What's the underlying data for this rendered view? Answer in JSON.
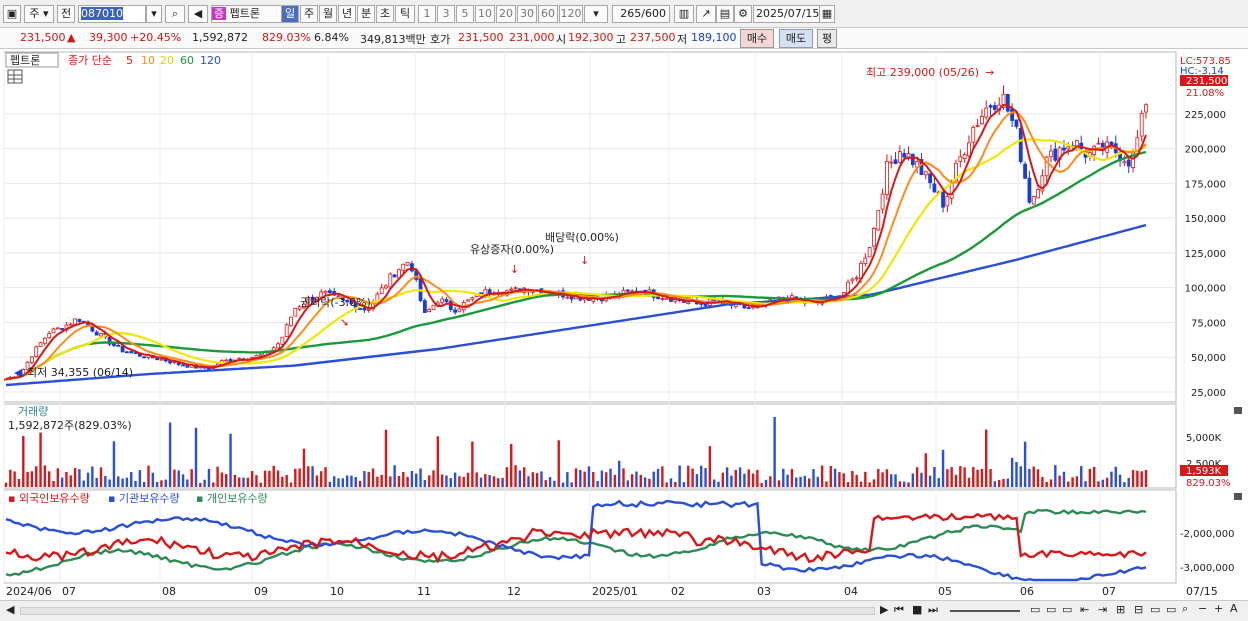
{
  "toolbar": {
    "item_type": "주",
    "prev_label": "전",
    "code": "087010",
    "stock_badge": "증",
    "stock_name": "펩트론",
    "period_buttons": [
      "일",
      "주",
      "월",
      "년",
      "분",
      "초",
      "틱"
    ],
    "active_period": "일",
    "interval_buttons": [
      "1",
      "3",
      "5",
      "10",
      "20",
      "30",
      "60",
      "120"
    ],
    "count": "265",
    "count_total": "/600",
    "date": "2025/07/15"
  },
  "infobar": {
    "price": "231,500",
    "change_arrow": "▲",
    "change": "39,300",
    "change_pct": "+20.45%",
    "volume": "1,592,872",
    "volume_ratio": "829.03%",
    "turnover": "6.84%",
    "amount": "349,813백만",
    "bid_label": "호가",
    "ask": "231,500",
    "bid": "231,000",
    "open_label": "시",
    "open": "192,300",
    "high_label": "고",
    "high": "237,500",
    "low_label": "저",
    "low": "189,100",
    "buy_label": "매수",
    "sell_label": "매도",
    "avg_label": "평"
  },
  "price_panel": {
    "stock_tab": "펩트론",
    "ma_legend": [
      "종가 단순",
      "5",
      "10",
      "20",
      "60",
      "120"
    ],
    "ma_colors": [
      "#d81818",
      "#ff8c1a",
      "#e8e000",
      "#1a9a3a",
      "#2a4fd8"
    ],
    "lc_label": "LC:573.85",
    "hc_label": "HC:-3.14",
    "last_price_tag": "231,500",
    "last_pct_tag": "21.08%",
    "y_ticks": [
      "225,000",
      "200,000",
      "175,000",
      "150,000",
      "125,000",
      "100,000",
      "75,000",
      "50,000",
      "25,000"
    ],
    "annotations": {
      "high": "최고 239,000 (05/26)",
      "low": "최저 34,355 (06/14)",
      "rights": "권리락(-3.0%)",
      "capital": "유상증자(0.00%)",
      "dividend": "배당락(0.00%)"
    }
  },
  "volume_panel": {
    "title": "거래량",
    "value": "1,592,872주(829.03%)",
    "y_ticks": [
      "5,000K",
      "2,500K"
    ],
    "last_tag": "1,593K",
    "last_pct": "829.03%"
  },
  "holding_panel": {
    "legend": [
      "외국인보유수량",
      "기관보유수량",
      "개인보유수량"
    ],
    "colors": [
      "#d81818",
      "#2a4fd8",
      "#2e8b57"
    ],
    "y_tick": "-2,000,000",
    "y_tick2": "-3,000,000"
  },
  "x_axis": [
    "2024/06",
    "07",
    "08",
    "09",
    "10",
    "11",
    "12",
    "2025/01",
    "02",
    "03",
    "04",
    "05",
    "06",
    "07",
    "07/15"
  ],
  "chart_data": {
    "type": "line",
    "title": "펩트론",
    "y_range": [
      25000,
      250000
    ],
    "series": [
      {
        "name": "종가",
        "points": [
          [
            0,
            34355
          ],
          [
            10,
            38000
          ],
          [
            20,
            55000
          ],
          [
            30,
            68000
          ],
          [
            40,
            72000
          ],
          [
            50,
            78000
          ],
          [
            60,
            70000
          ],
          [
            70,
            62000
          ],
          [
            80,
            55000
          ],
          [
            90,
            52000
          ],
          [
            100,
            50000
          ],
          [
            110,
            48000
          ],
          [
            120,
            45000
          ],
          [
            130,
            43000
          ],
          [
            140,
            42000
          ],
          [
            150,
            47000
          ],
          [
            160,
            49000
          ],
          [
            170,
            50000
          ],
          [
            180,
            52000
          ],
          [
            190,
            61000
          ],
          [
            200,
            85000
          ],
          [
            210,
            92000
          ],
          [
            220,
            96000
          ],
          [
            230,
            91000
          ],
          [
            240,
            88000
          ],
          [
            250,
            84000
          ],
          [
            260,
            98000
          ],
          [
            270,
            112000
          ],
          [
            280,
            120000
          ],
          [
            290,
            80000
          ],
          [
            300,
            92000
          ],
          [
            310,
            84000
          ],
          [
            320,
            90000
          ],
          [
            330,
            96000
          ],
          [
            340,
            99000
          ],
          [
            350,
            97000
          ],
          [
            360,
            100000
          ],
          [
            370,
            98000
          ],
          [
            380,
            96000
          ],
          [
            390,
            95000
          ],
          [
            400,
            93000
          ],
          [
            410,
            93000
          ],
          [
            420,
            94000
          ],
          [
            430,
            96000
          ],
          [
            440,
            98000
          ],
          [
            450,
            95000
          ],
          [
            460,
            93000
          ],
          [
            470,
            90000
          ],
          [
            480,
            88000
          ],
          [
            490,
            90000
          ],
          [
            500,
            88000
          ],
          [
            510,
            86000
          ],
          [
            520,
            85000
          ],
          [
            530,
            89000
          ],
          [
            540,
            93000
          ],
          [
            550,
            90000
          ],
          [
            560,
            88000
          ],
          [
            570,
            92000
          ],
          [
            580,
            96000
          ],
          [
            590,
            110000
          ],
          [
            600,
            135000
          ],
          [
            610,
            185000
          ],
          [
            620,
            200000
          ],
          [
            630,
            190000
          ],
          [
            640,
            175000
          ],
          [
            650,
            160000
          ],
          [
            660,
            190000
          ],
          [
            670,
            215000
          ],
          [
            680,
            230000
          ],
          [
            690,
            239000
          ],
          [
            700,
            212000
          ],
          [
            710,
            160000
          ],
          [
            720,
            190000
          ],
          [
            730,
            200000
          ],
          [
            740,
            205000
          ],
          [
            750,
            195000
          ],
          [
            760,
            200000
          ],
          [
            770,
            198000
          ],
          [
            780,
            190000
          ],
          [
            790,
            231500
          ]
        ]
      },
      {
        "name": "120",
        "points": [
          [
            0,
            30000
          ],
          [
            100,
            38000
          ],
          [
            200,
            44000
          ],
          [
            300,
            56000
          ],
          [
            400,
            72000
          ],
          [
            500,
            88000
          ],
          [
            600,
            95000
          ],
          [
            700,
            120000
          ],
          [
            790,
            145000
          ]
        ]
      }
    ]
  }
}
